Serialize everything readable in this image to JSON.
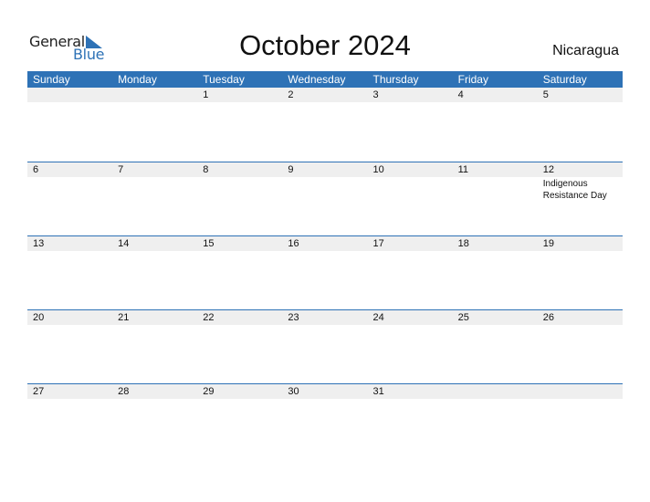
{
  "logo": {
    "word1": "General",
    "word2": "Blue",
    "icon": "triangle-flag-icon"
  },
  "title": "October 2024",
  "country": "Nicaragua",
  "colors": {
    "accent": "#2e72b6",
    "date_row_bg": "#efefef"
  },
  "weekdays": [
    "Sunday",
    "Monday",
    "Tuesday",
    "Wednesday",
    "Thursday",
    "Friday",
    "Saturday"
  ],
  "weeks": [
    {
      "days": [
        "",
        "",
        "1",
        "2",
        "3",
        "4",
        "5"
      ],
      "events": [
        "",
        "",
        "",
        "",
        "",
        "",
        ""
      ]
    },
    {
      "days": [
        "6",
        "7",
        "8",
        "9",
        "10",
        "11",
        "12"
      ],
      "events": [
        "",
        "",
        "",
        "",
        "",
        "",
        "Indigenous Resistance Day"
      ]
    },
    {
      "days": [
        "13",
        "14",
        "15",
        "16",
        "17",
        "18",
        "19"
      ],
      "events": [
        "",
        "",
        "",
        "",
        "",
        "",
        ""
      ]
    },
    {
      "days": [
        "20",
        "21",
        "22",
        "23",
        "24",
        "25",
        "26"
      ],
      "events": [
        "",
        "",
        "",
        "",
        "",
        "",
        ""
      ]
    },
    {
      "days": [
        "27",
        "28",
        "29",
        "30",
        "31",
        "",
        ""
      ],
      "events": [
        "",
        "",
        "",
        "",
        "",
        "",
        ""
      ]
    }
  ]
}
